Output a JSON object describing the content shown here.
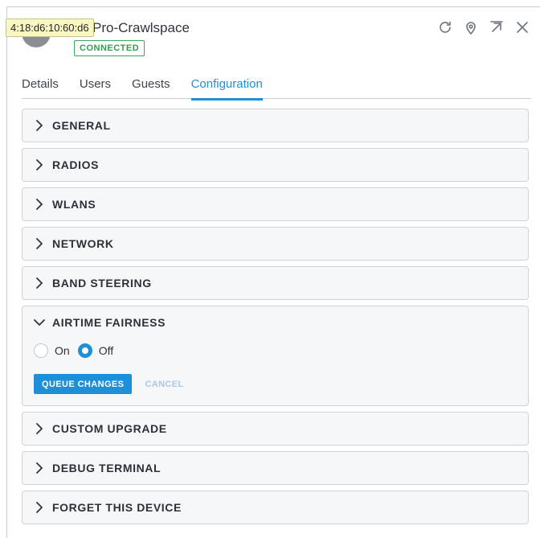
{
  "header": {
    "mac_tooltip": "4:18:d6:10:60:d6",
    "device_name": "AP-Pro-Crawlspace",
    "device_name_visible": "Pro-Crawlspace",
    "status": "CONNECTED",
    "icons": [
      "refresh-icon",
      "locate-icon",
      "popout-icon",
      "close-icon"
    ]
  },
  "tabs": [
    {
      "label": "Details"
    },
    {
      "label": "Users"
    },
    {
      "label": "Guests"
    },
    {
      "label": "Configuration",
      "active": true
    }
  ],
  "sections": [
    {
      "title": "GENERAL"
    },
    {
      "title": "RADIOS"
    },
    {
      "title": "WLANS"
    },
    {
      "title": "NETWORK"
    },
    {
      "title": "BAND STEERING"
    },
    {
      "title": "AIRTIME FAIRNESS",
      "open": true
    },
    {
      "title": "CUSTOM UPGRADE"
    },
    {
      "title": "DEBUG TERMINAL"
    },
    {
      "title": "FORGET THIS DEVICE"
    }
  ],
  "airtime": {
    "option_on": "On",
    "option_off": "Off",
    "selected": "Off",
    "queue_label": "QUEUE CHANGES",
    "cancel_label": "CANCEL"
  },
  "colors": {
    "accent": "#1f8fd6",
    "connected": "#2e9e50",
    "tooltip_bg": "#fbf7c2"
  }
}
